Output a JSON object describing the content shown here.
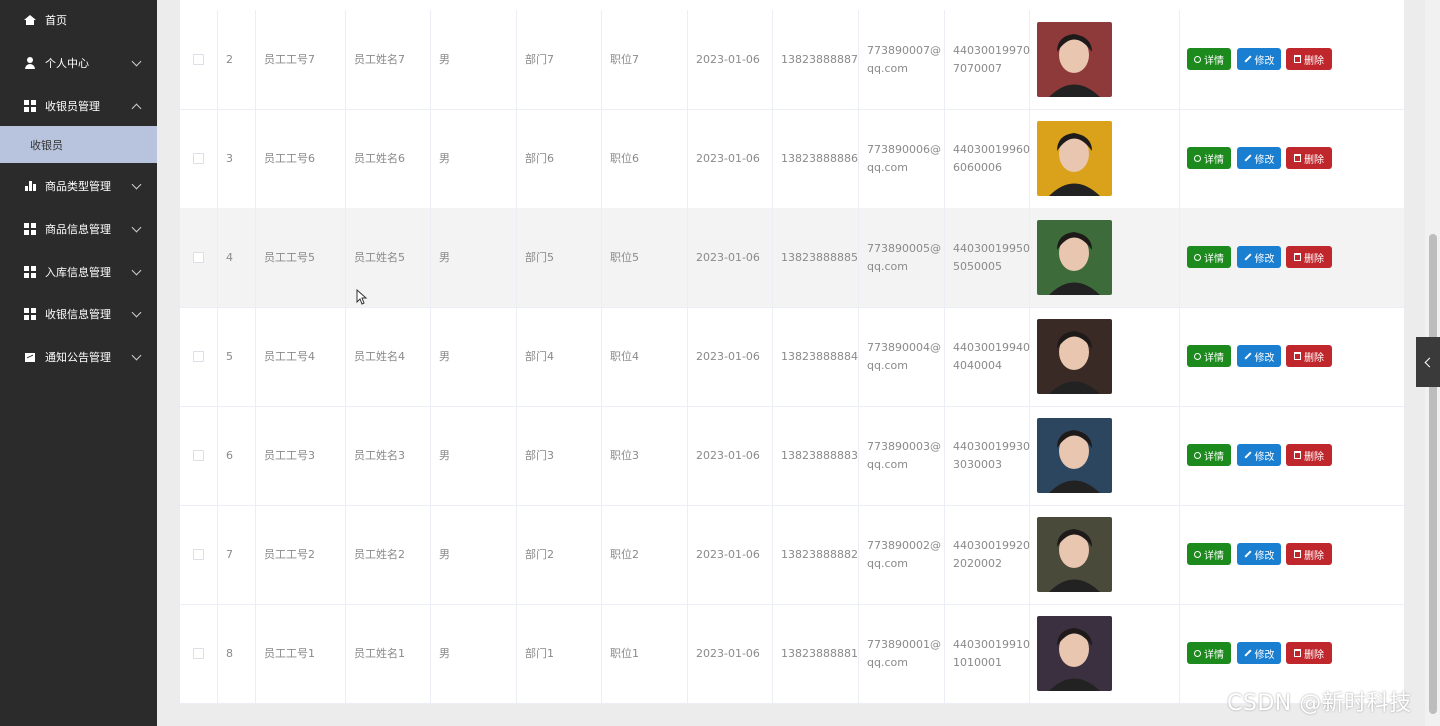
{
  "sidebar": {
    "items": [
      {
        "label": "首页",
        "icon": "home-icon",
        "chevron": "none"
      },
      {
        "label": "个人中心",
        "icon": "user-icon",
        "chevron": "down"
      },
      {
        "label": "收银员管理",
        "icon": "grid-icon",
        "chevron": "up"
      },
      {
        "label": "商品类型管理",
        "icon": "bar-chart-icon",
        "chevron": "down"
      },
      {
        "label": "商品信息管理",
        "icon": "grid-icon",
        "chevron": "down"
      },
      {
        "label": "入库信息管理",
        "icon": "grid-icon",
        "chevron": "down"
      },
      {
        "label": "收银信息管理",
        "icon": "grid-icon",
        "chevron": "down"
      },
      {
        "label": "通知公告管理",
        "icon": "picture-icon",
        "chevron": "down"
      }
    ],
    "active_sub_item": "收银员"
  },
  "table": {
    "rows": [
      {
        "index": "2",
        "emp_no": "员工工号7",
        "name": "员工姓名7",
        "gender": "男",
        "dept": "部门7",
        "position": "职位7",
        "date": "2023-01-06",
        "phone": "13823888887",
        "email_1": "773890007@",
        "email_2": "qq.com",
        "id_1": "44030019970",
        "id_2": "7070007",
        "photo_color": "#8f3a3a"
      },
      {
        "index": "3",
        "emp_no": "员工工号6",
        "name": "员工姓名6",
        "gender": "男",
        "dept": "部门6",
        "position": "职位6",
        "date": "2023-01-06",
        "phone": "13823888886",
        "email_1": "773890006@",
        "email_2": "qq.com",
        "id_1": "44030019960",
        "id_2": "6060006",
        "photo_color": "#d9a21a"
      },
      {
        "index": "4",
        "emp_no": "员工工号5",
        "name": "员工姓名5",
        "gender": "男",
        "dept": "部门5",
        "position": "职位5",
        "date": "2023-01-06",
        "phone": "13823888885",
        "email_1": "773890005@",
        "email_2": "qq.com",
        "id_1": "44030019950",
        "id_2": "5050005",
        "photo_color": "#3e6b3a"
      },
      {
        "index": "5",
        "emp_no": "员工工号4",
        "name": "员工姓名4",
        "gender": "男",
        "dept": "部门4",
        "position": "职位4",
        "date": "2023-01-06",
        "phone": "13823888884",
        "email_1": "773890004@",
        "email_2": "qq.com",
        "id_1": "44030019940",
        "id_2": "4040004",
        "photo_color": "#3a2a26"
      },
      {
        "index": "6",
        "emp_no": "员工工号3",
        "name": "员工姓名3",
        "gender": "男",
        "dept": "部门3",
        "position": "职位3",
        "date": "2023-01-06",
        "phone": "13823888883",
        "email_1": "773890003@",
        "email_2": "qq.com",
        "id_1": "44030019930",
        "id_2": "3030003",
        "photo_color": "#2d4660"
      },
      {
        "index": "7",
        "emp_no": "员工工号2",
        "name": "员工姓名2",
        "gender": "男",
        "dept": "部门2",
        "position": "职位2",
        "date": "2023-01-06",
        "phone": "13823888882",
        "email_1": "773890002@",
        "email_2": "qq.com",
        "id_1": "44030019920",
        "id_2": "2020002",
        "photo_color": "#4a4a3a"
      },
      {
        "index": "8",
        "emp_no": "员工工号1",
        "name": "员工姓名1",
        "gender": "男",
        "dept": "部门1",
        "position": "职位1",
        "date": "2023-01-06",
        "phone": "13823888881",
        "email_1": "773890001@",
        "email_2": "qq.com",
        "id_1": "44030019910",
        "id_2": "1010001",
        "photo_color": "#3b3040"
      }
    ],
    "actions": {
      "detail": "详情",
      "edit": "修改",
      "delete": "删除"
    }
  },
  "watermark": "CSDN @新时科技",
  "colors": {
    "sidebar_bg": "#2b2b2b",
    "active_sub_bg": "#b8c4dd",
    "detail_btn": "#1c8a1c",
    "edit_btn": "#1a7fd1",
    "delete_btn": "#c0272d"
  }
}
